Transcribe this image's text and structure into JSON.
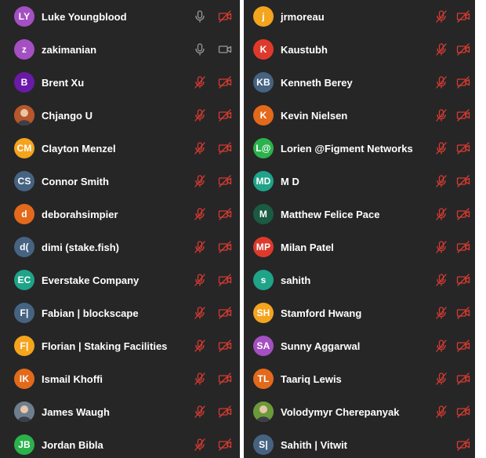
{
  "colors": {
    "panel_bg": "#262627",
    "name_text": "#ffffff",
    "muted_icon": "#d83b30",
    "active_icon": "#9a9a9a"
  },
  "left_participants": [
    {
      "initials": "LY",
      "name": "Luke Youngblood",
      "avatar_color": "#a44fc2",
      "mic": "on",
      "video": "off"
    },
    {
      "initials": "z",
      "name": "zakimanian",
      "avatar_color": "#a44fc2",
      "mic": "on",
      "video": "on"
    },
    {
      "initials": "B",
      "name": "Brent Xu",
      "avatar_color": "#6a1aa8",
      "mic": "off",
      "video": "off"
    },
    {
      "initials": "",
      "name": "Chjango U",
      "avatar_color": "#b8562c",
      "photo": true,
      "mic": "off",
      "video": "off"
    },
    {
      "initials": "CM",
      "name": "Clayton Menzel",
      "avatar_color": "#f4a41d",
      "mic": "off",
      "video": "off"
    },
    {
      "initials": "CS",
      "name": "Connor Smith",
      "avatar_color": "#466381",
      "mic": "off",
      "video": "off"
    },
    {
      "initials": "d",
      "name": "deborahsimpier",
      "avatar_color": "#e3691b",
      "mic": "off",
      "video": "off"
    },
    {
      "initials": "d(",
      "name": "dimi (stake.fish)",
      "avatar_color": "#466381",
      "mic": "off",
      "video": "off"
    },
    {
      "initials": "EC",
      "name": "Everstake Company",
      "avatar_color": "#1fa389",
      "mic": "off",
      "video": "off"
    },
    {
      "initials": "F|",
      "name": "Fabian | blockscape",
      "avatar_color": "#466381",
      "mic": "off",
      "video": "off"
    },
    {
      "initials": "F|",
      "name": "Florian | Staking Facilities",
      "avatar_color": "#f4a41d",
      "mic": "off",
      "video": "off"
    },
    {
      "initials": "IK",
      "name": "Ismail Khoffi",
      "avatar_color": "#e3691b",
      "mic": "off",
      "video": "off"
    },
    {
      "initials": "",
      "name": "James Waugh",
      "avatar_color": "#6f7e8c",
      "photo": true,
      "mic": "off",
      "video": "off"
    },
    {
      "initials": "JB",
      "name": "Jordan Bibla",
      "avatar_color": "#2bb24c",
      "mic": "off",
      "video": "off"
    }
  ],
  "right_participants": [
    {
      "initials": "j",
      "name": "jrmoreau",
      "avatar_color": "#f4a41d",
      "mic": "off",
      "video": "off"
    },
    {
      "initials": "K",
      "name": "Kaustubh",
      "avatar_color": "#de3a2c",
      "mic": "off",
      "video": "off"
    },
    {
      "initials": "KB",
      "name": "Kenneth Berey",
      "avatar_color": "#466381",
      "mic": "off",
      "video": "off"
    },
    {
      "initials": "K",
      "name": "Kevin Nielsen",
      "avatar_color": "#e3691b",
      "mic": "off",
      "video": "off"
    },
    {
      "initials": "L@",
      "name": "Lorien @Figment Networks",
      "avatar_color": "#2bb24c",
      "mic": "off",
      "video": "off"
    },
    {
      "initials": "MD",
      "name": "M D",
      "avatar_color": "#1fa389",
      "mic": "off",
      "video": "off"
    },
    {
      "initials": "M",
      "name": "Matthew Felice Pace",
      "avatar_color": "#1a5b42",
      "mic": "off",
      "video": "off"
    },
    {
      "initials": "MP",
      "name": "Milan Patel",
      "avatar_color": "#de3a2c",
      "mic": "off",
      "video": "off"
    },
    {
      "initials": "s",
      "name": "sahith",
      "avatar_color": "#1fa389",
      "mic": "off",
      "video": "off"
    },
    {
      "initials": "SH",
      "name": "Stamford Hwang",
      "avatar_color": "#f4a41d",
      "mic": "off",
      "video": "off"
    },
    {
      "initials": "SA",
      "name": "Sunny Aggarwal",
      "avatar_color": "#a44fc2",
      "mic": "off",
      "video": "off"
    },
    {
      "initials": "TL",
      "name": "Taariq Lewis",
      "avatar_color": "#e3691b",
      "mic": "off",
      "video": "off"
    },
    {
      "initials": "",
      "name": "Volodymyr Cherepanyak",
      "avatar_color": "#6b9a3a",
      "photo": true,
      "mic": "off",
      "video": "off"
    },
    {
      "initials": "S|",
      "name": "Sahith | Vitwit",
      "avatar_color": "#466381",
      "mic": "none",
      "video": "off"
    }
  ]
}
